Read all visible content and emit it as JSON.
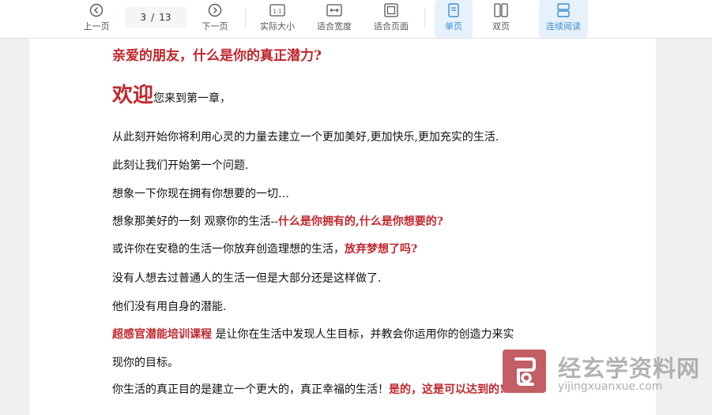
{
  "toolbar": {
    "prev_label": "上一页",
    "page_current": "3",
    "page_sep": "/",
    "page_total": "13",
    "next_label": "下一页",
    "actual_size_label": "实际大小",
    "fit_width_label": "适合宽度",
    "fit_page_label": "适合页面",
    "single_page_label": "单页",
    "double_page_label": "双页",
    "continuous_label": "连续阅读",
    "actual_size_icon_text": "1:1",
    "active_color": "#3a8fd6"
  },
  "document": {
    "heading": "亲爱的朋友，什么是你的真正潜力?",
    "welcome_big": "欢迎",
    "welcome_rest": "您来到第一章，",
    "p1": "从此刻开始你将利用心灵的力量去建立一个更加美好,更加快乐,更加充实的生活.",
    "p2": "此刻让我们开始第一个问题.",
    "p3": "想象一下你现在拥有你想要的一切…",
    "p4_plain": "想象那美好的一刻 观察你的生活--",
    "p4_red": "什么是你拥有的,什么是你想要的?",
    "p5_plain": "或许你在安稳的生活一你放弃创造理想的生活，",
    "p5_red": "放弃梦想了吗?",
    "p6": "没有人想去过普通人的生活一但是大部分还是这样做了.",
    "p7": "他们没有用自身的潜能.",
    "p8_red": "超感官潜能培训课程",
    "p8_plain": " 是让你在生活中发现人生目标，并教会你运用你的创造力来实",
    "p9": "现你的目标。",
    "p10_plain": "你生活的真正目的是建立一个更大的，真正幸福的生活！",
    "p10_red": "是的，这是可以达到的!",
    "accent_red": "#c0272d"
  },
  "watermark": {
    "text": "经玄学资料网",
    "url": "yijingxuanxue.com"
  }
}
